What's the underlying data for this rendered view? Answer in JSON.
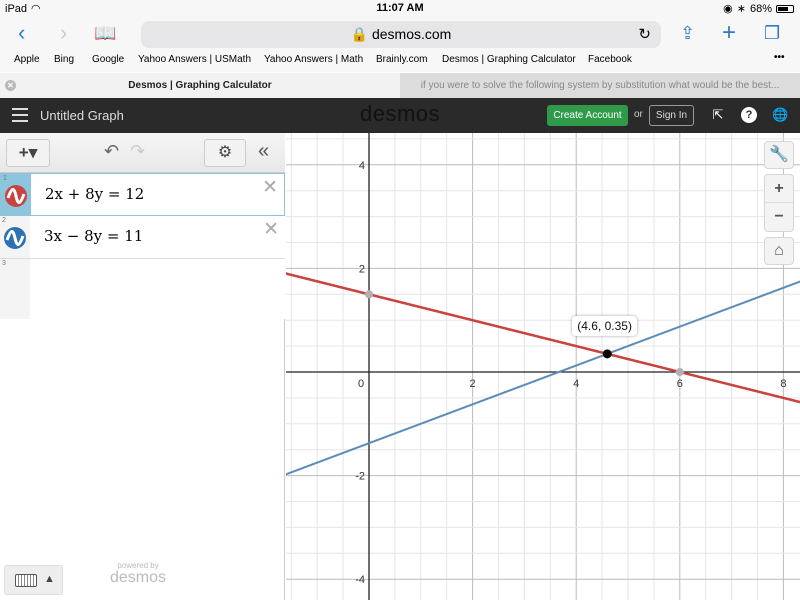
{
  "status_bar": {
    "device": "iPad",
    "time": "11:07 AM",
    "battery": "68%",
    "battery_fraction": 0.68
  },
  "browser": {
    "url": "desmos.com",
    "bookmarks": [
      "Apple",
      "Bing",
      "Google",
      "Yahoo Answers | USMath",
      "Yahoo Answers | Math",
      "Brainly.com",
      "Desmos | Graphing Calculator",
      "Facebook"
    ],
    "more": "•••",
    "tabs": [
      {
        "label": "Desmos | Graphing Calculator",
        "active": true
      },
      {
        "label": "if you were to solve the following system by substitution what would be the best...",
        "active": false
      }
    ]
  },
  "header": {
    "title": "Untitled Graph",
    "logo": "desmos",
    "create_account": "Create Account",
    "or": "or",
    "sign_in": "Sign In"
  },
  "toolbar": {
    "add": "+▾",
    "undo": "↶",
    "redo": "↷",
    "settings": "⚙",
    "collapse": "«"
  },
  "expressions": [
    {
      "num": "1",
      "latex": "2x + 8y = 12",
      "color": "#c74440",
      "selected": true
    },
    {
      "num": "2",
      "latex": "3x − 8y = 11",
      "color": "#2d70b3",
      "selected": false
    },
    {
      "num": "3",
      "latex": "",
      "color": "",
      "selected": false
    }
  ],
  "footer": {
    "powered_by": "powered by",
    "brand": "desmos"
  },
  "graph_controls": {
    "wrench": "🔧",
    "zoom_in": "+",
    "zoom_out": "−",
    "home": "⌂"
  },
  "chart_data": {
    "type": "line",
    "title": "",
    "xlabel": "",
    "ylabel": "",
    "xlim": [
      -1.6,
      8.3
    ],
    "ylim": [
      -4.4,
      4.5
    ],
    "grid": true,
    "x_ticks": [
      "0",
      "2",
      "4",
      "6",
      "8"
    ],
    "y_ticks": [
      "4",
      "2",
      "-2",
      "-4"
    ],
    "series": [
      {
        "name": "2x + 8y = 12",
        "color": "#c74440",
        "slope": -0.25,
        "intercept": 1.5
      },
      {
        "name": "3x − 8y = 11",
        "color": "#5b8cb8",
        "slope": 0.375,
        "intercept": -1.375
      }
    ],
    "points": [
      {
        "x": 0,
        "y": 1.5,
        "color": "#b0b0b0"
      },
      {
        "x": 6,
        "y": 0,
        "color": "#b0b0b0"
      },
      {
        "x": 4.6,
        "y": 0.35,
        "color": "#000000",
        "label": "(4.6, 0.35)"
      }
    ]
  }
}
